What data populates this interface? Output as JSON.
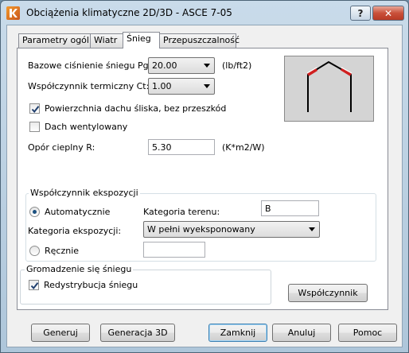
{
  "window": {
    "title": "Obciążenia klimatyczne 2D/3D - ASCE 7-05",
    "help_glyph": "?",
    "close_glyph": "✕"
  },
  "tabs": [
    {
      "label": "Parametry ogólne",
      "active": false
    },
    {
      "label": "Wiatr",
      "active": false
    },
    {
      "label": "Śnieg",
      "active": true
    },
    {
      "label": "Przepuszczalność",
      "active": false
    }
  ],
  "snow": {
    "pressure_label": "Bazowe ciśnienie śniegu Pg:",
    "pressure_value": "20.00",
    "pressure_unit": "(lb/ft2)",
    "thermal_label": "Współczynnik termiczny Ct:",
    "thermal_value": "1.00",
    "slippery_label": "Powierzchnia dachu śliska, bez przeszkód",
    "slippery_checked": true,
    "ventilated_label": "Dach wentylowany",
    "ventilated_checked": false,
    "resistance_label": "Opór cieplny R:",
    "resistance_value": "5.30",
    "resistance_unit": "(K*m2/W)"
  },
  "exposure": {
    "group_label": "Współczynnik ekspozycji",
    "auto_label": "Automatycznie",
    "auto_selected": true,
    "terrain_label": "Kategoria terenu:",
    "terrain_value": "B",
    "category_label": "Kategoria ekspozycji:",
    "category_value": "W pełni wyeksponowany",
    "manual_label": "Ręcznie",
    "manual_value": ""
  },
  "drift": {
    "group_label": "Gromadzenie się śniegu",
    "redistribution_label": "Redystrybucja śniegu",
    "redistribution_checked": true,
    "coefficient_button": "Współczynnik"
  },
  "buttons": {
    "generate": "Generuj",
    "generate_3d": "Generacja 3D",
    "close": "Zamknij",
    "cancel": "Anuluj",
    "help": "Pomoc"
  },
  "colors": {
    "snow_accent": "#d02020"
  }
}
